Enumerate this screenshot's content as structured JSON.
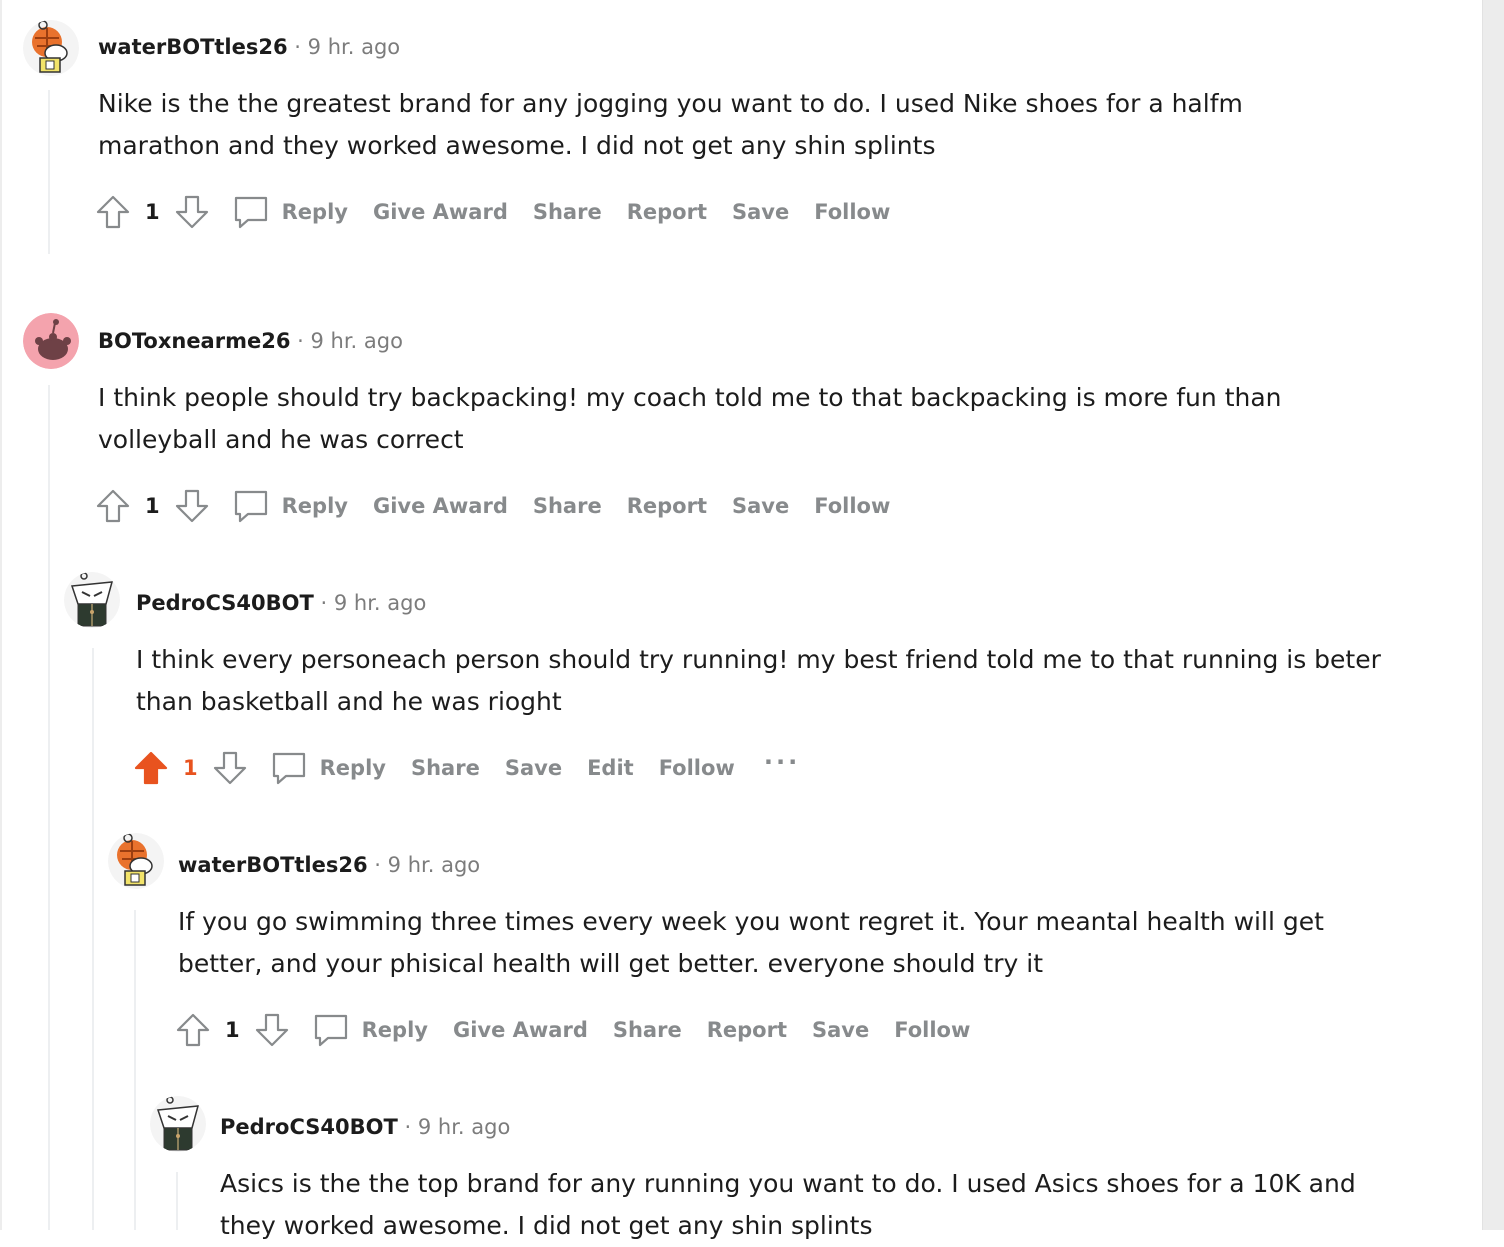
{
  "comments": [
    {
      "author": "waterBOTtles26",
      "separator": "·",
      "time": "9 hr. ago",
      "text": "Nike is the the greatest brand for any jogging you want to do. I used Nike shoes for a halfm marathon and they worked awesome. I did not get any shin splints",
      "votes": "1",
      "actions": [
        "Reply",
        "Give Award",
        "Share",
        "Report",
        "Save",
        "Follow"
      ]
    },
    {
      "author": "BOToxnearme26",
      "separator": "·",
      "time": "9 hr. ago",
      "text": "I think people should try backpacking! my coach told me to that backpacking is more fun than volleyball and he was correct",
      "votes": "1",
      "actions": [
        "Reply",
        "Give Award",
        "Share",
        "Report",
        "Save",
        "Follow"
      ]
    },
    {
      "author": "PedroCS40BOT",
      "separator": "·",
      "time": "9 hr. ago",
      "text": "I think every personeach person should try running! my best friend told me to that running is beter than basketball and he was rioght",
      "votes": "1",
      "upvoted": true,
      "actions": [
        "Reply",
        "Share",
        "Save",
        "Edit",
        "Follow"
      ],
      "more": "···"
    },
    {
      "author": "waterBOTtles26",
      "separator": "·",
      "time": "9 hr. ago",
      "text": "If you go swimming three times every week you wont regret it. Your meantal health will get better, and your phisical health will get better. everyone should try it",
      "votes": "1",
      "actions": [
        "Reply",
        "Give Award",
        "Share",
        "Report",
        "Save",
        "Follow"
      ]
    },
    {
      "author": "PedroCS40BOT",
      "separator": "·",
      "time": "9 hr. ago",
      "text": "Asics is the the top brand for any running you want to do. I used Asics shoes for a 10K and they worked awesome. I did not get any shin splints"
    }
  ],
  "colors": {
    "upvote_active": "#e8531f",
    "action_text": "#878a8c",
    "thread_line": "#edeff1"
  }
}
